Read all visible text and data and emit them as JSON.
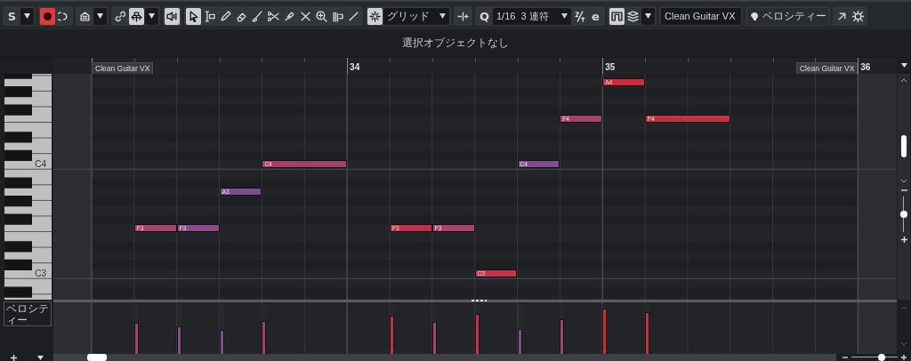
{
  "toolbar": [
    [
      {
        "kind": "text-icon",
        "text": "S",
        "selected": false
      },
      {
        "kind": "caret"
      }
    ],
    [
      {
        "kind": "record",
        "on": true
      },
      {
        "kind": "icon",
        "selected": false
      }
    ],
    [
      {
        "kind": "icon",
        "selected": false
      },
      {
        "kind": "caret"
      }
    ],
    [
      {
        "kind": "icon",
        "selected": false
      },
      {
        "kind": "icon",
        "selected": true
      },
      {
        "kind": "caret"
      }
    ],
    [
      {
        "kind": "icon",
        "selected": true
      }
    ],
    [
      {
        "kind": "icon",
        "selected": true
      },
      {
        "kind": "icon",
        "selected": false
      },
      {
        "kind": "icon",
        "selected": false
      },
      {
        "kind": "icon",
        "selected": false
      },
      {
        "kind": "icon",
        "selected": false
      },
      {
        "kind": "icon",
        "selected": false
      },
      {
        "kind": "icon",
        "selected": false
      },
      {
        "kind": "icon",
        "selected": false
      },
      {
        "kind": "icon",
        "selected": false
      },
      {
        "kind": "icon",
        "selected": false
      },
      {
        "kind": "icon",
        "selected": false
      }
    ],
    [
      {
        "kind": "icon",
        "selected": true
      },
      {
        "kind": "dropdown",
        "value": "グリッド"
      }
    ],
    [
      {
        "kind": "icon",
        "selected": false
      }
    ],
    [
      {
        "kind": "text-icon",
        "text": "Q",
        "selected": false
      },
      {
        "kind": "dropdown",
        "value": "1/16  3 連符"
      },
      {
        "kind": "icon",
        "selected": false
      },
      {
        "kind": "text-icon",
        "text": "e",
        "selected": false
      }
    ],
    [
      {
        "kind": "icon",
        "selected": true
      },
      {
        "kind": "icon",
        "selected": false
      },
      {
        "kind": "caret"
      }
    ],
    [
      {
        "kind": "dropdown",
        "value": "Clean Guitar VX"
      }
    ],
    [
      {
        "kind": "icon-dropdown",
        "value": "ベロシティー"
      }
    ],
    [
      {
        "kind": "icon",
        "selected": false
      },
      {
        "kind": "icon",
        "selected": false
      }
    ]
  ],
  "info_line": "選択オブジェクトなし",
  "ruler": {
    "part_start_label": "Clean Guitar VX",
    "part_end_label": "Clean Guitar VX",
    "bars": [
      "34",
      "35",
      "36"
    ]
  },
  "keyboard": {
    "labels": [
      "C4",
      "C3"
    ]
  },
  "notes": [
    {
      "label": "F3",
      "color": "#a34468",
      "level": 0.63
    },
    {
      "label": "F3",
      "color": "#8a4b8c",
      "level": 0.55
    },
    {
      "label": "A3",
      "color": "#7c4f8e",
      "level": 0.48
    },
    {
      "label": "C4",
      "color": "#a33f62",
      "level": 0.66
    },
    {
      "label": "F3",
      "color": "#c0304a",
      "level": 0.77
    },
    {
      "label": "F3",
      "color": "#a8436c",
      "level": 0.64
    },
    {
      "label": "C3",
      "color": "#c4344c",
      "level": 0.8
    },
    {
      "label": "C4",
      "color": "#7d4f8d",
      "level": 0.5
    },
    {
      "label": "F4",
      "color": "#a3456c",
      "level": 0.7
    },
    {
      "label": "A4",
      "color": "#d12a3a",
      "level": 0.91
    },
    {
      "label": "F4",
      "color": "#c3323f",
      "level": 0.84
    }
  ],
  "velocity_lane": {
    "label": "ベロシティー"
  },
  "vertical_zoom": {
    "level": 0.5
  },
  "horizontal_zoom": {
    "level": 0.65
  }
}
